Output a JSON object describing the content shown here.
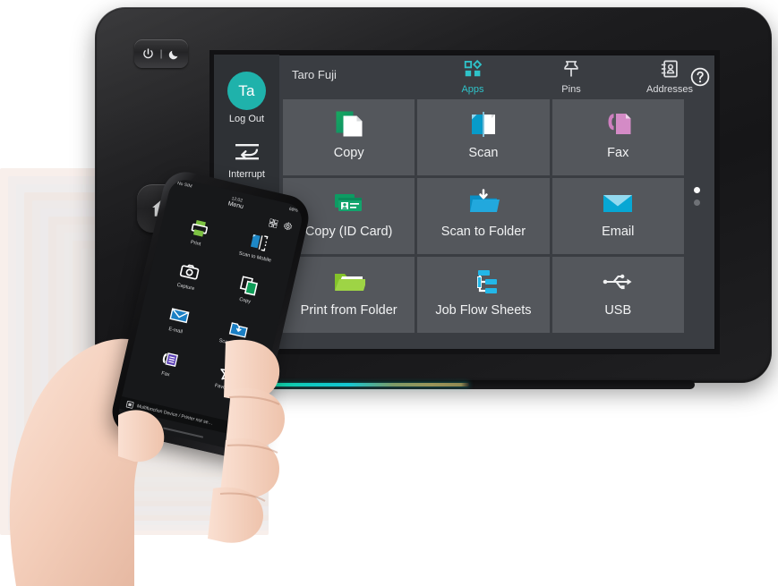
{
  "device": {
    "name": "multifunction-printer-control-panel",
    "hardware_buttons": [
      {
        "name": "power-sleep-button",
        "icon": "power-moon-icon",
        "label": ""
      },
      {
        "name": "home-button",
        "icon": "home-icon",
        "label": ""
      }
    ],
    "led_colors": [
      "#0bbf6a",
      "#0fc9c2",
      "#9a9458"
    ]
  },
  "screen": {
    "background": "#3a3d42",
    "tile_color": "#54575c",
    "accent": "#2fc3c9",
    "rail": {
      "avatar_initials": "Ta",
      "avatar_color": "#1fb2ab",
      "logout_label": "Log Out",
      "interrupt_label": "Interrupt"
    },
    "header": {
      "user_name": "Taro Fuji",
      "nav": [
        {
          "label": "Apps",
          "icon": "apps-grid-icon",
          "active": true
        },
        {
          "label": "Pins",
          "icon": "pin-icon",
          "active": false
        },
        {
          "label": "Addresses",
          "icon": "address-book-icon",
          "active": false
        }
      ],
      "help_icon": "help-question-icon"
    },
    "tiles": [
      [
        {
          "label": "Copy",
          "icon": "copy-pages-icon"
        },
        {
          "label": "Scan",
          "icon": "scan-pages-icon"
        },
        {
          "label": "Fax",
          "icon": "fax-handset-icon"
        }
      ],
      [
        {
          "label": "Copy (ID Card)",
          "icon": "id-card-icon"
        },
        {
          "label": "Scan to Folder",
          "icon": "scan-to-folder-icon"
        },
        {
          "label": "Email",
          "icon": "envelope-icon"
        }
      ],
      [
        {
          "label": "Print from Folder",
          "icon": "open-folder-icon"
        },
        {
          "label": "Job Flow Sheets",
          "icon": "job-flow-icon"
        },
        {
          "label": "USB",
          "icon": "usb-icon"
        }
      ]
    ],
    "page_dots": {
      "total": 2,
      "active_index": 0
    }
  },
  "phone": {
    "status": {
      "carrier": "No SIM",
      "time": "12:02",
      "battery": "68%"
    },
    "title": "Menu",
    "toolbar": [
      {
        "name": "qr-scan-icon"
      },
      {
        "name": "settings-gear-icon"
      }
    ],
    "menu_items": [
      {
        "label": "Print",
        "icon": "printer-icon"
      },
      {
        "label": "Scan to Mobile",
        "icon": "scan-to-mobile-icon"
      },
      {
        "label": "Capture",
        "icon": "camera-icon"
      },
      {
        "label": "Copy",
        "icon": "copy-pages-icon"
      },
      {
        "label": "E-mail",
        "icon": "envelope-icon"
      },
      {
        "label": "Scan to Folder",
        "icon": "scan-to-folder-icon"
      },
      {
        "label": "Fax",
        "icon": "fax-handset-icon"
      },
      {
        "label": "Favorites",
        "icon": "star-icon"
      }
    ],
    "footer": {
      "icon": "device-icon",
      "text": "Multifunction Device / Printer not se…"
    }
  }
}
